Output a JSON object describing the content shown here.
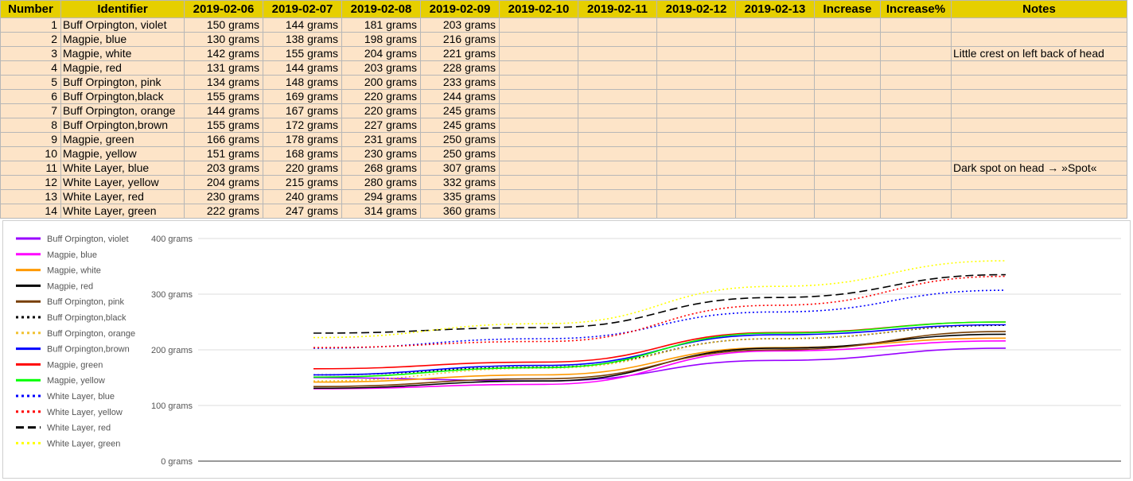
{
  "columns": [
    "Number",
    "Identifier",
    "2019-02-06",
    "2019-02-07",
    "2019-02-08",
    "2019-02-09",
    "2019-02-10",
    "2019-02-11",
    "2019-02-12",
    "2019-02-13",
    "Increase",
    "Increase%",
    "Notes"
  ],
  "rows": [
    {
      "number": "1",
      "identifier": "Buff Orpington, violet",
      "w1": "150 grams",
      "w2": "144 grams",
      "w3": "181 grams",
      "w4": "203 grams",
      "note": ""
    },
    {
      "number": "2",
      "identifier": "Magpie, blue",
      "w1": "130 grams",
      "w2": "138 grams",
      "w3": "198 grams",
      "w4": "216 grams",
      "note": ""
    },
    {
      "number": "3",
      "identifier": "Magpie, white",
      "w1": "142 grams",
      "w2": "155 grams",
      "w3": "204 grams",
      "w4": "221 grams",
      "note": "Little crest on left back of head"
    },
    {
      "number": "4",
      "identifier": "Magpie, red",
      "w1": "131 grams",
      "w2": "144 grams",
      "w3": "203 grams",
      "w4": "228 grams",
      "note": ""
    },
    {
      "number": "5",
      "identifier": "Buff Orpington, pink",
      "w1": "134 grams",
      "w2": "148 grams",
      "w3": "200 grams",
      "w4": "233 grams",
      "note": ""
    },
    {
      "number": "6",
      "identifier": "Buff Orpington,black",
      "w1": "155 grams",
      "w2": "169 grams",
      "w3": "220 grams",
      "w4": "244 grams",
      "note": ""
    },
    {
      "number": "7",
      "identifier": "Buff Orpington, orange",
      "w1": "144 grams",
      "w2": "167 grams",
      "w3": "220 grams",
      "w4": "245 grams",
      "note": ""
    },
    {
      "number": "8",
      "identifier": "Buff Orpington,brown",
      "w1": "155 grams",
      "w2": "172 grams",
      "w3": "227 grams",
      "w4": "245 grams",
      "note": ""
    },
    {
      "number": "9",
      "identifier": "Magpie, green",
      "w1": "166 grams",
      "w2": "178 grams",
      "w3": "231 grams",
      "w4": "250 grams",
      "note": ""
    },
    {
      "number": "10",
      "identifier": "Magpie, yellow",
      "w1": "151 grams",
      "w2": "168 grams",
      "w3": "230 grams",
      "w4": "250 grams",
      "note": ""
    },
    {
      "number": "11",
      "identifier": "White Layer, blue",
      "w1": "203 grams",
      "w2": "220 grams",
      "w3": "268 grams",
      "w4": "307 grams",
      "note": "Dark spot on head → »Spot«"
    },
    {
      "number": "12",
      "identifier": "White Layer, yellow",
      "w1": "204 grams",
      "w2": "215 grams",
      "w3": "280 grams",
      "w4": "332 grams",
      "note": ""
    },
    {
      "number": "13",
      "identifier": "White Layer, red",
      "w1": "230 grams",
      "w2": "240 grams",
      "w3": "294 grams",
      "w4": "335 grams",
      "note": ""
    },
    {
      "number": "14",
      "identifier": "White Layer, green",
      "w1": "222 grams",
      "w2": "247 grams",
      "w3": "314 grams",
      "w4": "360 grams",
      "note": ""
    }
  ],
  "chart_data": {
    "type": "line",
    "x": [
      "2019-02-06",
      "2019-02-07",
      "2019-02-08",
      "2019-02-09"
    ],
    "xlabel": "",
    "ylabel": "",
    "ylim": [
      0,
      400
    ],
    "y_ticks": [
      "400 grams",
      "300 grams",
      "200 grams",
      "100 grams",
      "0 grams"
    ],
    "grid": true,
    "legend_position": "left",
    "series": [
      {
        "name": "Buff Orpington, violet",
        "values": [
          150,
          144,
          181,
          203
        ],
        "color": "#9900ff",
        "dash": "solid"
      },
      {
        "name": "Magpie, blue",
        "values": [
          130,
          138,
          198,
          216
        ],
        "color": "#ff00ff",
        "dash": "solid"
      },
      {
        "name": "Magpie, white",
        "values": [
          142,
          155,
          204,
          221
        ],
        "color": "#ff9900",
        "dash": "solid"
      },
      {
        "name": "Magpie, red",
        "values": [
          131,
          144,
          203,
          228
        ],
        "color": "#000000",
        "dash": "solid"
      },
      {
        "name": "Buff Orpington, pink",
        "values": [
          134,
          148,
          200,
          233
        ],
        "color": "#783f04",
        "dash": "solid"
      },
      {
        "name": "Buff Orpington,black",
        "values": [
          155,
          169,
          220,
          244
        ],
        "color": "#000000",
        "dash": "dotted"
      },
      {
        "name": "Buff Orpington, orange",
        "values": [
          144,
          167,
          220,
          245
        ],
        "color": "#f1c232",
        "dash": "dotted"
      },
      {
        "name": "Buff Orpington,brown",
        "values": [
          155,
          172,
          227,
          245
        ],
        "color": "#0000ff",
        "dash": "solid"
      },
      {
        "name": "Magpie, green",
        "values": [
          166,
          178,
          231,
          250
        ],
        "color": "#ff0000",
        "dash": "solid"
      },
      {
        "name": "Magpie, yellow",
        "values": [
          151,
          168,
          230,
          250
        ],
        "color": "#00ff00",
        "dash": "solid"
      },
      {
        "name": "White Layer, blue",
        "values": [
          203,
          220,
          268,
          307
        ],
        "color": "#0000ff",
        "dash": "dotted"
      },
      {
        "name": "White Layer, yellow",
        "values": [
          204,
          215,
          280,
          332
        ],
        "color": "#ff0000",
        "dash": "dotted"
      },
      {
        "name": "White Layer, red",
        "values": [
          230,
          240,
          294,
          335
        ],
        "color": "#000000",
        "dash": "dashed"
      },
      {
        "name": "White Layer, green",
        "values": [
          222,
          247,
          314,
          360
        ],
        "color": "#ffff00",
        "dash": "dotted"
      }
    ]
  }
}
